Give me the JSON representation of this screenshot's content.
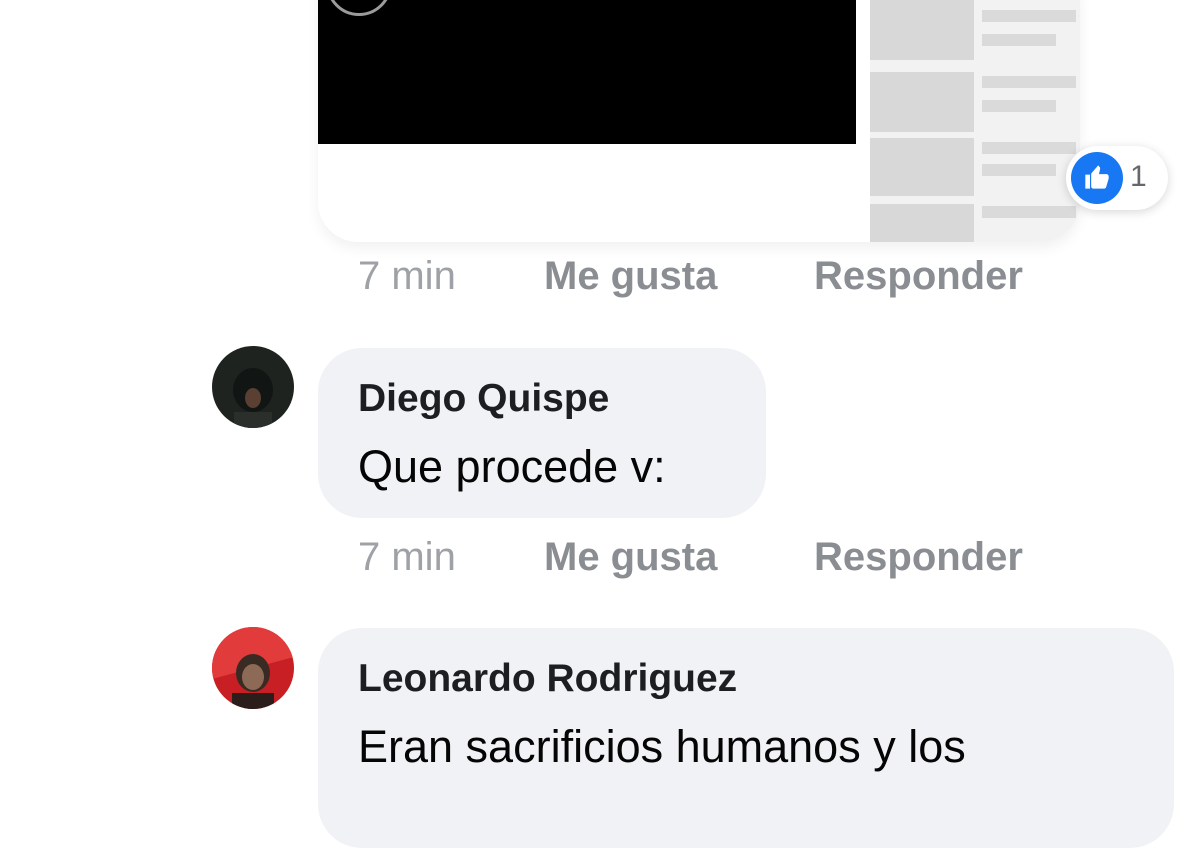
{
  "top_comment": {
    "like_count": "1",
    "actions": {
      "time": "7 min",
      "like": "Me gusta",
      "reply": "Responder"
    }
  },
  "comments": [
    {
      "author": "Diego Quispe",
      "text": "Que procede v:",
      "actions": {
        "time": "7 min",
        "like": "Me gusta",
        "reply": "Responder"
      }
    },
    {
      "author": "Leonardo Rodriguez",
      "text": "Eran sacrificios humanos y los"
    }
  ],
  "icons": {
    "like": "thumbs-up-icon",
    "play": "play-icon"
  },
  "colors": {
    "like_blue": "#1877f2",
    "bubble": "#f0f2f5",
    "action_gray": "#8a8d91"
  }
}
